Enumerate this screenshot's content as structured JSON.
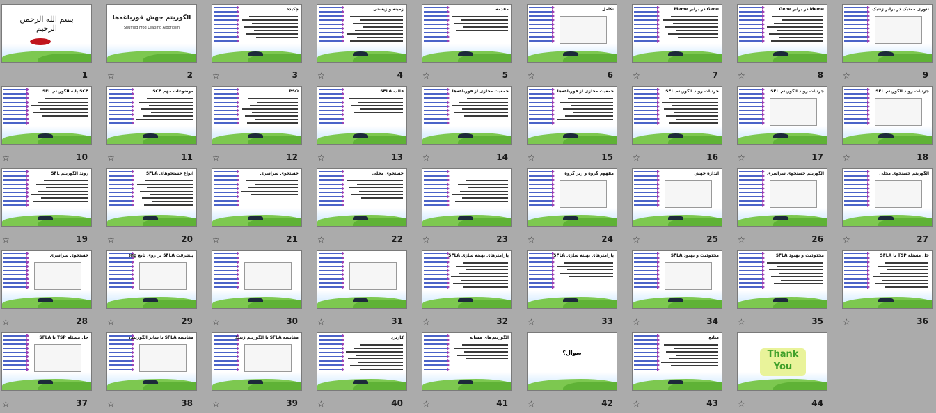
{
  "slides": [
    {
      "num": "1",
      "kind": "calligraphy",
      "star": false,
      "title": "",
      "logo_text": "بسم الله الرحمن الرحیم"
    },
    {
      "num": "2",
      "kind": "title",
      "star": true,
      "title": "الگوریتم جهش قورباغه‌ها",
      "subtitle": "Shuffled Frog Leaping Algorithm"
    },
    {
      "num": "3",
      "kind": "content",
      "star": true,
      "title": "چکیده"
    },
    {
      "num": "4",
      "kind": "content",
      "star": true,
      "title": "زمینه و زیستی"
    },
    {
      "num": "5",
      "kind": "content",
      "star": true,
      "title": "مقدمه"
    },
    {
      "num": "6",
      "kind": "figure",
      "star": true,
      "title": "تکامل"
    },
    {
      "num": "7",
      "kind": "content",
      "star": true,
      "title": "Gene در برابر Meme"
    },
    {
      "num": "8",
      "kind": "content",
      "star": true,
      "title": "Meme در برابر Gene"
    },
    {
      "num": "9",
      "kind": "figure",
      "star": true,
      "title": "تئوری ممتیک در برابر ژنتیک"
    },
    {
      "num": "10",
      "kind": "content",
      "star": true,
      "title": "SCE پایه الگوریتم SFL"
    },
    {
      "num": "11",
      "kind": "content",
      "star": true,
      "title": "موضوعات مهم SCE"
    },
    {
      "num": "12",
      "kind": "content",
      "star": true,
      "title": "PSO"
    },
    {
      "num": "13",
      "kind": "content",
      "star": true,
      "title": "قالب SFLA"
    },
    {
      "num": "14",
      "kind": "content",
      "star": true,
      "title": "جمعیت مجازی از قورباغه‌ها"
    },
    {
      "num": "15",
      "kind": "content",
      "star": true,
      "title": "جمعیت مجازی از قورباغه‌ها"
    },
    {
      "num": "16",
      "kind": "content",
      "star": true,
      "title": "جزئیات روند الگوریتم SFL"
    },
    {
      "num": "17",
      "kind": "figure",
      "star": true,
      "title": "جزئیات روند الگوریتم SFL"
    },
    {
      "num": "18",
      "kind": "figure",
      "star": true,
      "title": "جزئیات روند الگوریتم SFL"
    },
    {
      "num": "19",
      "kind": "content",
      "star": true,
      "title": "روند الگوریتم SFL"
    },
    {
      "num": "20",
      "kind": "content",
      "star": true,
      "title": "انواع جستجوهای SFLA"
    },
    {
      "num": "21",
      "kind": "content",
      "star": true,
      "title": "جستجوی سراسری"
    },
    {
      "num": "22",
      "kind": "content",
      "star": true,
      "title": "جستجوی محلی"
    },
    {
      "num": "23",
      "kind": "content",
      "star": true,
      "title": ""
    },
    {
      "num": "24",
      "kind": "figure",
      "star": true,
      "title": "مفهوم گروه و زیر گروه"
    },
    {
      "num": "25",
      "kind": "figure",
      "star": true,
      "title": "اندازه جهش"
    },
    {
      "num": "26",
      "kind": "figure",
      "star": true,
      "title": "الگوریتم جستجوی سراسری"
    },
    {
      "num": "27",
      "kind": "figure",
      "star": true,
      "title": "الگوریتم جستجوی محلی"
    },
    {
      "num": "28",
      "kind": "figure",
      "star": true,
      "title": "جستجوی سراسری"
    },
    {
      "num": "29",
      "kind": "figure",
      "star": true,
      "title": "پیشرفت SFLA بر روی تابع DeJong"
    },
    {
      "num": "30",
      "kind": "figure",
      "star": true,
      "title": ""
    },
    {
      "num": "31",
      "kind": "figure",
      "star": true,
      "title": ""
    },
    {
      "num": "32",
      "kind": "content",
      "star": true,
      "title": "پارامترهای بهینه سازی SFLA"
    },
    {
      "num": "33",
      "kind": "content",
      "star": true,
      "title": "پارامترهای بهینه سازی SFLA"
    },
    {
      "num": "34",
      "kind": "figure",
      "star": true,
      "title": "محدودیت و بهبود SFLA"
    },
    {
      "num": "35",
      "kind": "content",
      "star": true,
      "title": "محدودیت و بهبود SFLA"
    },
    {
      "num": "36",
      "kind": "content",
      "star": true,
      "title": "حل مسئله TSP با SFLA"
    },
    {
      "num": "37",
      "kind": "figure",
      "star": true,
      "title": "حل مسئله TSP با SFLA"
    },
    {
      "num": "38",
      "kind": "figure",
      "star": true,
      "title": "مقایسه SFLA با سایر الگوریتم‌ها"
    },
    {
      "num": "39",
      "kind": "figure",
      "star": true,
      "title": "مقایسه SFLA با الگوریتم ژنتیک"
    },
    {
      "num": "40",
      "kind": "content",
      "star": true,
      "title": "کاربرد"
    },
    {
      "num": "41",
      "kind": "content",
      "star": true,
      "title": "الگوریتم‌های مشابه"
    },
    {
      "num": "42",
      "kind": "question",
      "star": true,
      "title": "سوال؟"
    },
    {
      "num": "43",
      "kind": "content",
      "star": true,
      "title": "منابع"
    },
    {
      "num": "44",
      "kind": "thanks",
      "star": true,
      "title": "",
      "logo_text": "Thank You"
    }
  ],
  "colors": {
    "background": "#ababab",
    "sidebar_bar": "#4b63c8",
    "arrow": "#9b3fb5",
    "grass": "#7dc850"
  },
  "star_icon": "star-outline-icon"
}
